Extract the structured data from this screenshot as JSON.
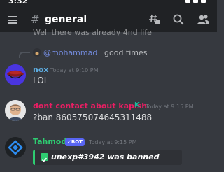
{
  "status_bar": {
    "time": "3:32"
  },
  "header": {
    "hash": "#",
    "channel_name": "general"
  },
  "messages": {
    "peek_text": "Well there was already 4nd life",
    "reply_mention": "@mohammad",
    "reply_text": "good times",
    "nox": {
      "username": "nox",
      "timestamp": "Today at 9:10 PM",
      "text": "LOL"
    },
    "dont": {
      "username": "dont contact about kapish",
      "badge": "K",
      "timestamp": "Today at 9:15 PM",
      "text": "?ban 860575074645311488"
    },
    "tahmod": {
      "username": "Tahmod",
      "bot_tag": "✓BOT",
      "timestamp": "Today at 9:15 PM",
      "embed_text": "unexp#3942 was banned"
    }
  },
  "colors": {
    "background": "#36393f",
    "header": "#202225",
    "blurple": "#7289da",
    "nox_name": "#5dade2",
    "dont_name": "#e91e63",
    "tahmod_name": "#2ecc71",
    "embed_accent": "#2ecc71"
  },
  "icons": [
    "hamburger-icon",
    "threads-icon",
    "search-icon",
    "members-icon",
    "check-icon"
  ]
}
